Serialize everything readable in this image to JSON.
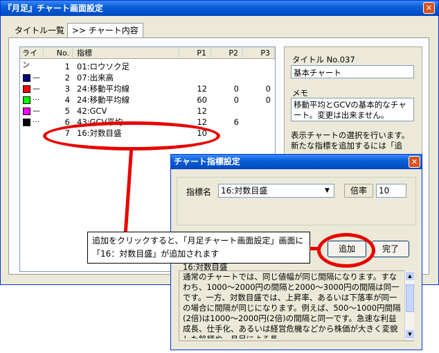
{
  "main_window": {
    "title": "『月足』チャート画面設定",
    "close_glyph": "✕",
    "tabs": [
      {
        "label": "タイトル一覧",
        "active": false
      },
      {
        "label": ">> チャート内容",
        "active": true
      }
    ]
  },
  "list": {
    "columns": [
      "ライン",
      "No.",
      "指標",
      "P1",
      "P2",
      "P3"
    ],
    "rows": [
      {
        "color": "",
        "line": "",
        "no": "1",
        "name": "01:ロウソク足",
        "p1": "",
        "p2": "",
        "p3": ""
      },
      {
        "color": "#000080",
        "line": "—",
        "no": "2",
        "name": "07:出来高",
        "p1": "",
        "p2": "",
        "p3": ""
      },
      {
        "color": "#ff0000",
        "line": "—",
        "no": "3",
        "name": "24:移動平均線",
        "p1": "12",
        "p2": "0",
        "p3": "0"
      },
      {
        "color": "#00ff00",
        "line": "···",
        "no": "4",
        "name": "24:移動平均線",
        "p1": "60",
        "p2": "0",
        "p3": "0"
      },
      {
        "color": "#ff00ff",
        "line": "—",
        "no": "5",
        "name": "42:GCV",
        "p1": "12",
        "p2": "",
        "p3": ""
      },
      {
        "color": "#000000",
        "line": "···",
        "no": "6",
        "name": "43:GCV平均",
        "p1": "12",
        "p2": "6",
        "p3": ""
      },
      {
        "color": "",
        "line": "",
        "no": "7",
        "name": "16:対数目盛",
        "p1": "10",
        "p2": "",
        "p3": ""
      }
    ]
  },
  "side": {
    "title_label": "タイトル No.037",
    "title_value": "基本チャート",
    "memo_label": "メモ",
    "memo_value": "移動平均とGCVの基本的なチャート。変更は出来ません。",
    "help_text": "表示チャートの選択を行います。新たな指標を追加するには「追"
  },
  "dialog": {
    "title": "チャート指標設定",
    "close_glyph": "✕",
    "indicator_label": "指標名",
    "indicator_value": "16:対数目盛",
    "dropdown_glyph": "▼",
    "rate_label": "倍率",
    "rate_value": "10",
    "add_label": "追加",
    "done_label": "完了",
    "desc_title": "16:対数目盛",
    "desc_text": "通常のチャートでは、同じ値幅が同じ間隔になります。すなわち、1000～2000円の間隔と2000～3000円の間隔は同一です。一方、対数目盛では、上昇率、あるいは下落率が同一の場合に間隔が同じになります。例えば、500～1000円間隔(2倍)は1000～2000円(2倍)の間隔と同一です。急速な利益成長、仕手化、あるいは経営危機などから株価が大きく変貌した銘柄や、月足による長"
  },
  "callout": {
    "text": "追加をクリックすると、「月足チャート画面設定」画面に「16：対数目盛」が追加されます"
  },
  "colors": {
    "titlebar": "#0a5fd8",
    "highlight": "#e80000"
  }
}
